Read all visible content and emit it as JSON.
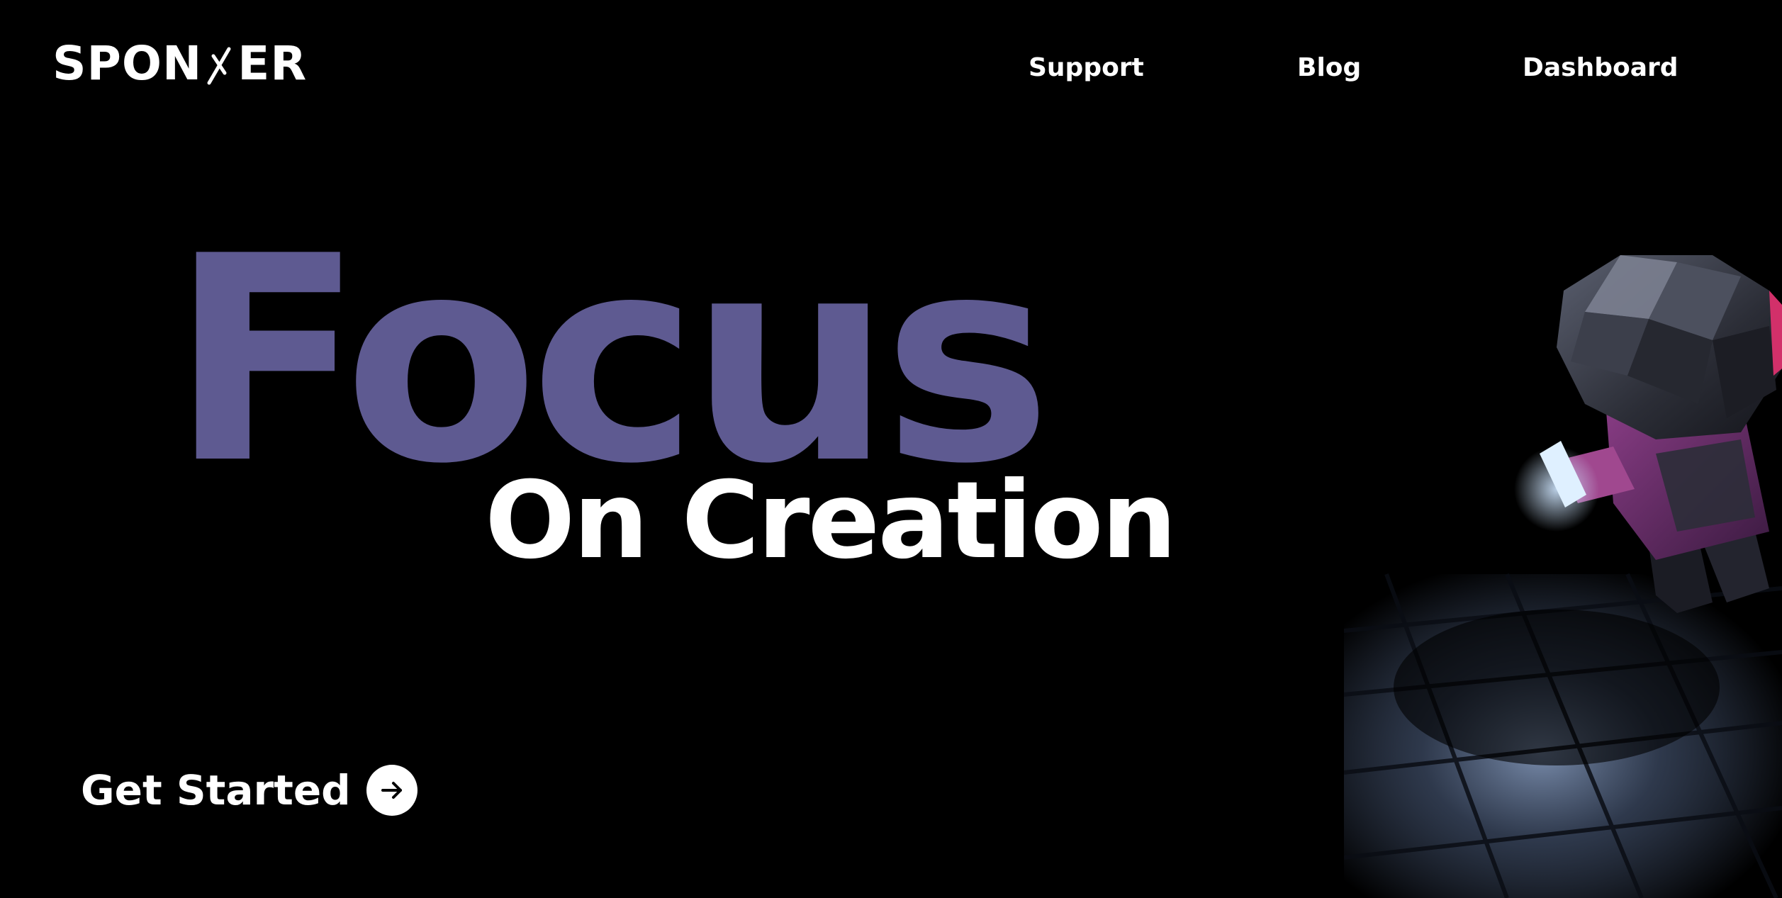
{
  "brand": {
    "logo_left": "SPON",
    "logo_right": "ER",
    "accent": "#5e5a91"
  },
  "nav": {
    "items": [
      {
        "label": "Support"
      },
      {
        "label": "Blog"
      },
      {
        "label": "Dashboard"
      }
    ]
  },
  "hero": {
    "title": "Focus",
    "subtitle": "On Creation",
    "cta_label": "Get Started",
    "cta_icon": "arrow-right-icon",
    "illustration": "low-poly-figure-with-phone"
  }
}
